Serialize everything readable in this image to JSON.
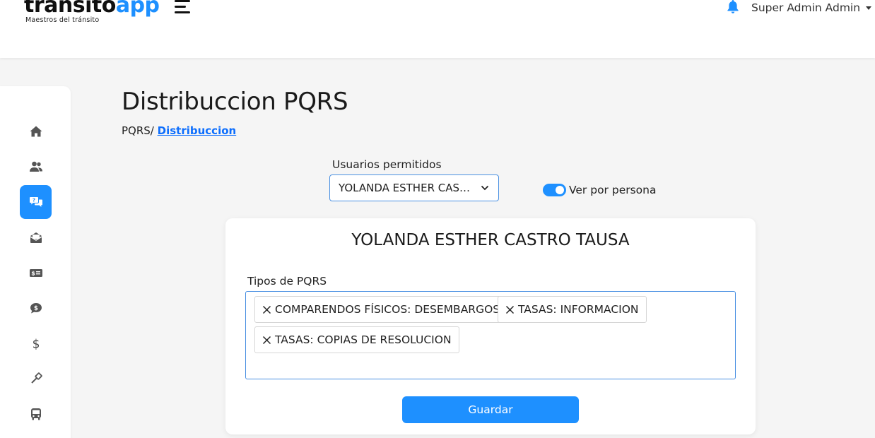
{
  "header": {
    "logo_part1": "transito",
    "logo_part2": "app",
    "logo_tagline": "Maestros del tránsito",
    "user_name": "Super Admin Admin",
    "brand_color": "#1e90ff"
  },
  "sidebar": {
    "items": [
      {
        "icon": "home-icon",
        "active": false
      },
      {
        "icon": "users-icon",
        "active": false
      },
      {
        "icon": "pqrs-chat-icon",
        "active": true
      },
      {
        "icon": "inbox-envelope-icon",
        "active": false
      },
      {
        "icon": "money-bill-icon",
        "active": false
      },
      {
        "icon": "dollar-bubble-icon",
        "active": false
      },
      {
        "icon": "dollar-icon",
        "active": false
      },
      {
        "icon": "gavel-icon",
        "active": false
      },
      {
        "icon": "bus-icon",
        "active": false
      }
    ]
  },
  "page": {
    "title": "Distribuccion PQRS",
    "breadcrumb_root": "PQRS/",
    "breadcrumb_current": "Distribuccion"
  },
  "filters": {
    "users_label": "Usuarios permitidos",
    "users_selected": "YOLANDA ESTHER CASTRO TAUSA",
    "toggle_label": "Ver por persona",
    "toggle_on": true
  },
  "card": {
    "person_name": "YOLANDA ESTHER CASTRO TAUSA",
    "types_label": "Tipos de PQRS",
    "chips": [
      "COMPARENDOS FÍSICOS: DESEMBARGOS",
      "TASAS: INFORMACION",
      "TASAS: COPIAS DE RESOLUCION"
    ],
    "save_label": "Guardar"
  }
}
